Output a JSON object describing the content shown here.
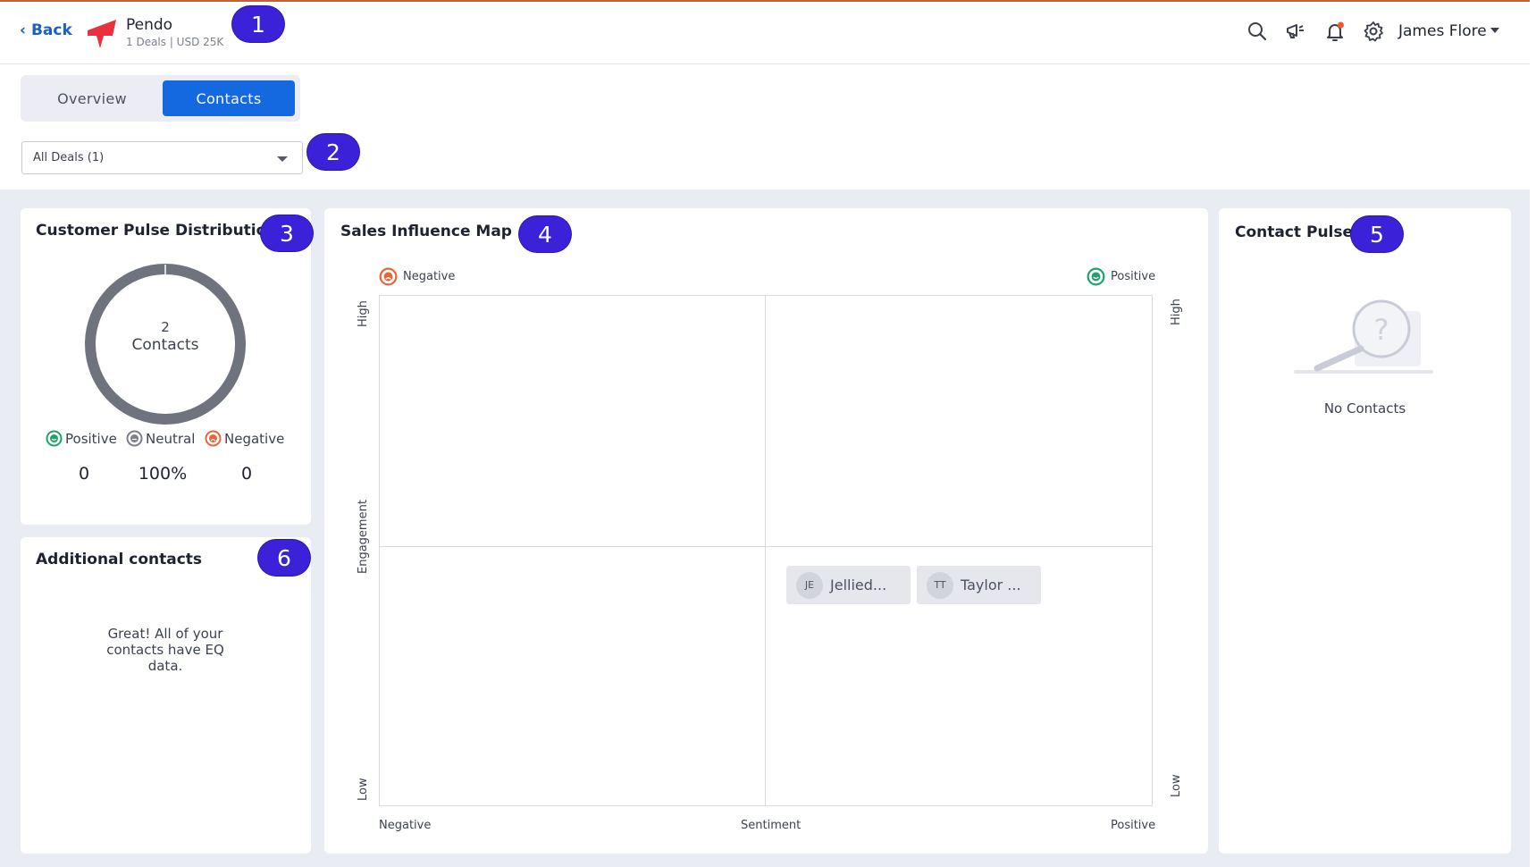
{
  "header": {
    "back_label": "Back",
    "account_name": "Pendo",
    "account_sub": "1 Deals | USD 25K",
    "user_name": "James Flore",
    "icons": [
      "search-icon",
      "megaphone-icon",
      "bell-icon",
      "gear-icon"
    ],
    "notification_dot_color": "#f05a28"
  },
  "tabs": [
    {
      "label": "Overview",
      "active": false
    },
    {
      "label": "Contacts",
      "active": true
    }
  ],
  "deal_select": {
    "value": "All Deals (1)"
  },
  "callouts": [
    "1",
    "2",
    "3",
    "4",
    "5",
    "6"
  ],
  "pulse": {
    "title": "Customer Pulse Distribution",
    "total": "2",
    "total_label": "Contacts",
    "legend": [
      {
        "label": "Positive",
        "value": "0",
        "color": "#1fa36b"
      },
      {
        "label": "Neutral",
        "value": "100%",
        "color": "#7b7f8a"
      },
      {
        "label": "Negative",
        "value": "0",
        "color": "#e8643a"
      }
    ],
    "neutral_share": 1.0
  },
  "additional": {
    "title": "Additional contacts",
    "message": "Great! All of your contacts have EQ data."
  },
  "influence_map": {
    "title": "Sales Influence Map",
    "top_left": "Negative",
    "top_right": "Positive",
    "y_high": "High",
    "y_low": "Low",
    "y_axis": "Engagement",
    "x_left": "Negative",
    "x_mid": "Sentiment",
    "x_right": "Positive",
    "contacts": [
      {
        "initials": "JE",
        "name": "Jellied..."
      },
      {
        "initials": "TT",
        "name": "Taylor ..."
      }
    ]
  },
  "contact_pulse": {
    "title": "Contact Pulse",
    "empty_text": "No Contacts"
  },
  "colors": {
    "accent": "#1468e0",
    "callout": "#3b22d8",
    "brand": "#e8303f"
  }
}
